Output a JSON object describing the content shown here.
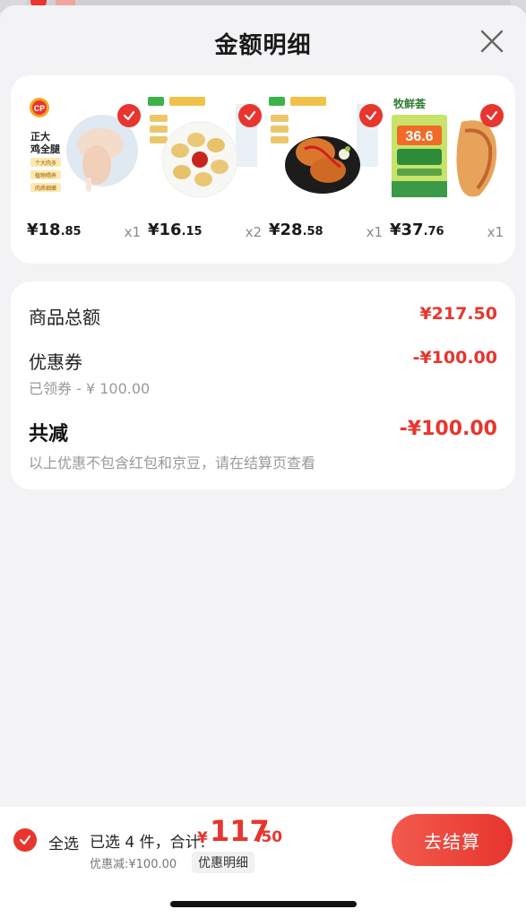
{
  "header": {
    "title": "金额明细"
  },
  "products": [
    {
      "image": "chicken-leg",
      "price_int": "¥18",
      "price_dec": ".85",
      "qty": "x1",
      "logo": "CP",
      "brand_lines": [
        "正大",
        "鸡全腿"
      ],
      "tags": [
        "个大肉多",
        "植物喂养",
        "肉质细嫩"
      ]
    },
    {
      "image": "chicken-nuggets",
      "price_int": "¥16",
      "price_dec": ".15",
      "qty": "x2"
    },
    {
      "image": "fried-chicken",
      "price_int": "¥28",
      "price_dec": ".58",
      "qty": "x1"
    },
    {
      "image": "chicken-breast",
      "price_int": "¥37",
      "price_dec": ".76",
      "qty": "x1",
      "brand": "牧鲜荟",
      "badge_number": "36.6"
    }
  ],
  "summary": {
    "subtotal_label": "商品总额",
    "subtotal_value": "¥217.50",
    "coupon_label": "优惠券",
    "coupon_value": "-¥100.00",
    "coupon_sub": "已领券 - ¥ 100.00",
    "total_discount_label": "共减",
    "total_discount_value": "-¥100.00",
    "note": "以上优惠不包含红包和京豆，请在结算页查看"
  },
  "bottom": {
    "select_all": "全选",
    "selected_text": "已选 4 件，合计:",
    "total_symbol": "¥",
    "total_int": "117",
    "total_dec": ".50",
    "discount_text": "优惠减:¥100.00",
    "detail_tag": "优惠明细",
    "checkout_label": "去结算"
  },
  "colors": {
    "accent": "#e8352d",
    "background": "#f3f3f5",
    "card": "#ffffff"
  }
}
